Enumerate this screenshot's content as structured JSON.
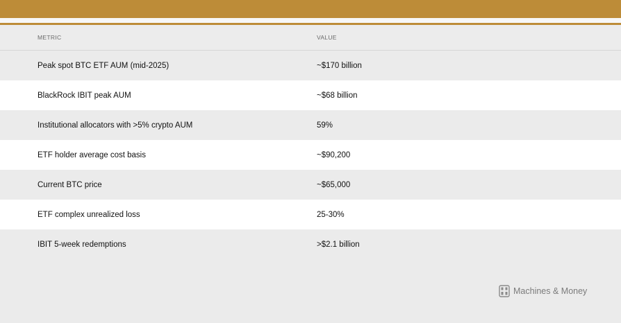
{
  "table": {
    "headers": {
      "metric": "METRIC",
      "value": "VALUE"
    },
    "rows": [
      {
        "metric": "Peak spot BTC ETF AUM (mid-2025)",
        "value": "~$170 billion"
      },
      {
        "metric": "BlackRock IBIT peak AUM",
        "value": "~$68 billion"
      },
      {
        "metric": "Institutional allocators with >5% crypto AUM",
        "value": "59%"
      },
      {
        "metric": "ETF holder average cost basis",
        "value": "~$90,200"
      },
      {
        "metric": "Current BTC price",
        "value": "~$65,000"
      },
      {
        "metric": "ETF complex unrealized loss",
        "value": "25-30%"
      },
      {
        "metric": "IBIT 5-week redemptions",
        "value": ">$2.1 billion"
      }
    ]
  },
  "brand": {
    "name": "Machines & Money",
    "icon": "machines-money-logo-icon"
  },
  "colors": {
    "accent": "#bd8c38",
    "row_shaded": "#ebebeb",
    "row_plain": "#ffffff"
  }
}
